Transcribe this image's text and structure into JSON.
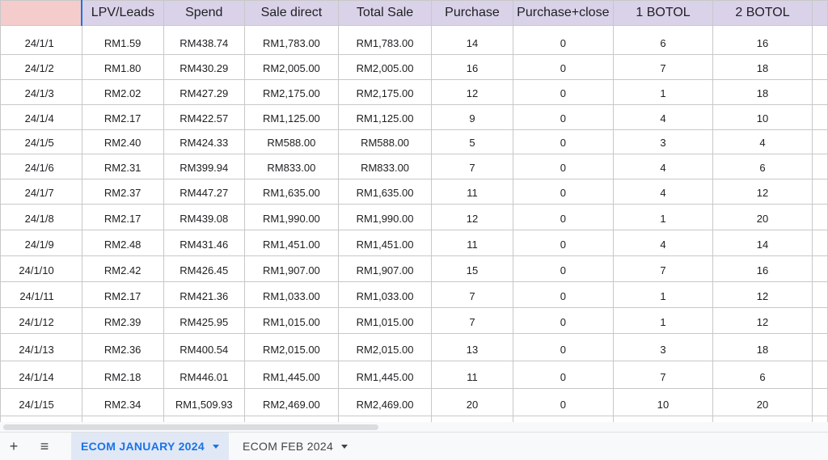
{
  "headers": [
    "",
    "LPV/Leads",
    "Spend",
    "Sale direct",
    "Total Sale",
    "Purchase",
    "Purchase+close",
    "1 BOTOL",
    "2 BOTOL"
  ],
  "rows": [
    [
      "24/1/1",
      "RM1.59",
      "RM438.74",
      "RM1,783.00",
      "RM1,783.00",
      "14",
      "0",
      "6",
      "16"
    ],
    [
      "24/1/2",
      "RM1.80",
      "RM430.29",
      "RM2,005.00",
      "RM2,005.00",
      "16",
      "0",
      "7",
      "18"
    ],
    [
      "24/1/3",
      "RM2.02",
      "RM427.29",
      "RM2,175.00",
      "RM2,175.00",
      "12",
      "0",
      "1",
      "18"
    ],
    [
      "24/1/4",
      "RM2.17",
      "RM422.57",
      "RM1,125.00",
      "RM1,125.00",
      "9",
      "0",
      "4",
      "10"
    ],
    [
      "24/1/5",
      "RM2.40",
      "RM424.33",
      "RM588.00",
      "RM588.00",
      "5",
      "0",
      "3",
      "4"
    ],
    [
      "24/1/6",
      "RM2.31",
      "RM399.94",
      "RM833.00",
      "RM833.00",
      "7",
      "0",
      "4",
      "6"
    ],
    [
      "24/1/7",
      "RM2.37",
      "RM447.27",
      "RM1,635.00",
      "RM1,635.00",
      "11",
      "0",
      "4",
      "12"
    ],
    [
      "24/1/8",
      "RM2.17",
      "RM439.08",
      "RM1,990.00",
      "RM1,990.00",
      "12",
      "0",
      "1",
      "20"
    ],
    [
      "24/1/9",
      "RM2.48",
      "RM431.46",
      "RM1,451.00",
      "RM1,451.00",
      "11",
      "0",
      "4",
      "14"
    ],
    [
      "24/1/10",
      "RM2.42",
      "RM426.45",
      "RM1,907.00",
      "RM1,907.00",
      "15",
      "0",
      "7",
      "16"
    ],
    [
      "24/1/11",
      "RM2.17",
      "RM421.36",
      "RM1,033.00",
      "RM1,033.00",
      "7",
      "0",
      "1",
      "12"
    ],
    [
      "24/1/12",
      "RM2.39",
      "RM425.95",
      "RM1,015.00",
      "RM1,015.00",
      "7",
      "0",
      "1",
      "12"
    ],
    [
      "24/1/13",
      "RM2.36",
      "RM400.54",
      "RM2,015.00",
      "RM2,015.00",
      "13",
      "0",
      "3",
      "18"
    ],
    [
      "24/1/14",
      "RM2.18",
      "RM446.01",
      "RM1,445.00",
      "RM1,445.00",
      "11",
      "0",
      "7",
      "6"
    ],
    [
      "24/1/15",
      "RM2.34",
      "RM1,509.93",
      "RM2,469.00",
      "RM2,469.00",
      "20",
      "0",
      "10",
      "20"
    ],
    [
      "",
      "",
      "",
      "",
      "",
      "",
      "",
      "",
      ""
    ]
  ],
  "tabs": {
    "add_icon": "+",
    "menu_icon": "≡",
    "sheets": [
      {
        "label": "ECOM JANUARY 2024",
        "active": true
      },
      {
        "label": "ECOM FEB 2024",
        "active": false
      }
    ]
  },
  "colors": {
    "header_bg": "#d9d2e9",
    "corner_bg": "#f4cccc",
    "active_tab_text": "#1a73e8",
    "active_tab_bg": "#e1e8f5"
  }
}
